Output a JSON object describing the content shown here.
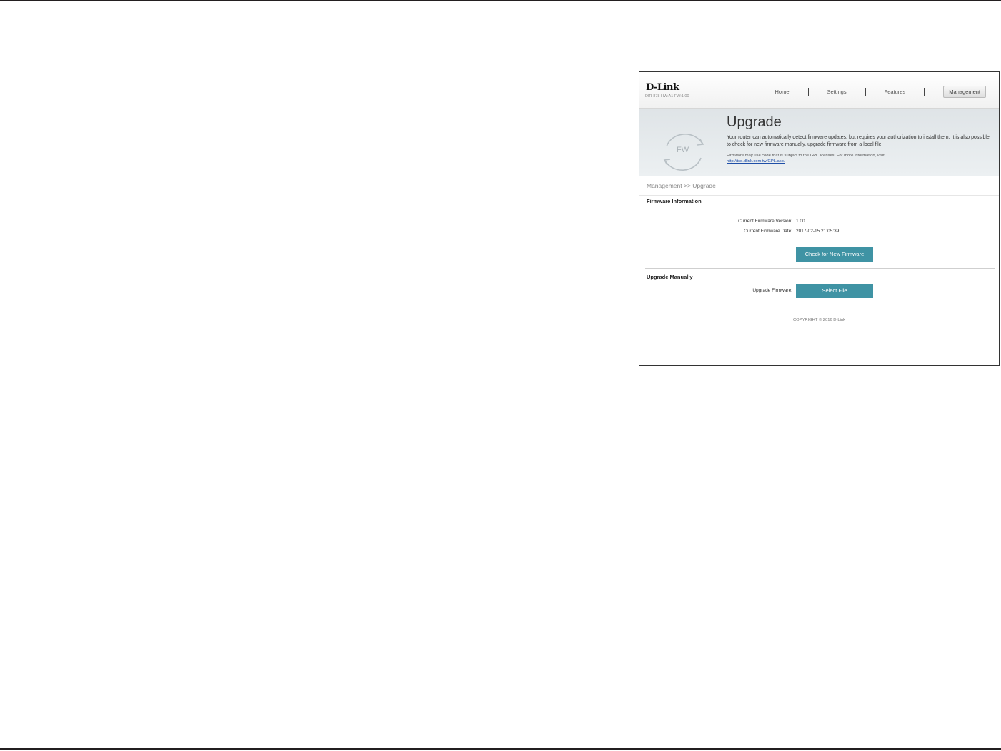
{
  "app": {
    "logo": "D-Link",
    "model": "DIR-878 HW:A1 FW:1.00"
  },
  "nav": {
    "items": [
      {
        "label": "Home"
      },
      {
        "label": "Settings"
      },
      {
        "label": "Features"
      },
      {
        "label": "Management",
        "active": true
      }
    ]
  },
  "banner": {
    "icon_text": "FW",
    "title": "Upgrade",
    "description": "Your router can automatically detect firmware updates, but requires your authorization to install them. It is also possible to check for new firmware manually, upgrade firmware from a local file.",
    "note": "Firmware may use code that is subject to the GPL licenses. For more information, visit",
    "link": "http://tsd.dlink.com.tw/GPL.asp."
  },
  "breadcrumb": "Management >> Upgrade",
  "firmware_info": {
    "title": "Firmware Information",
    "version_label": "Current Firmware Version:",
    "version_value": "1.00",
    "date_label": "Current Firmware Date:",
    "date_value": "2017-02-15 21:05:39",
    "check_button": "Check for New Firmware"
  },
  "upgrade_manually": {
    "title": "Upgrade Manually",
    "label": "Upgrade Firmware:",
    "select_button": "Select File"
  },
  "footer": {
    "copyright": "COPYRIGHT © 2016 D-Link"
  },
  "colors": {
    "button": "#3f93a4",
    "link": "#1f4fa8",
    "banner": "#e5e9ec"
  },
  "icons": [
    "refresh-arrows-icon"
  ]
}
